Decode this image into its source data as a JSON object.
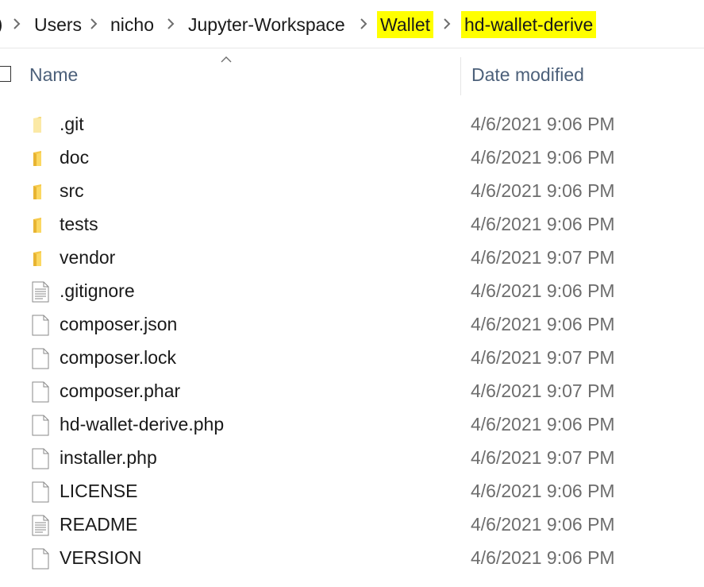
{
  "breadcrumb": {
    "items": [
      {
        "label": "Users",
        "highlighted": false
      },
      {
        "label": "nicho",
        "highlighted": false
      },
      {
        "label": "Jupyter-Workspace",
        "highlighted": false
      },
      {
        "label": "Wallet",
        "highlighted": true
      },
      {
        "label": "hd-wallet-derive",
        "highlighted": true
      }
    ],
    "highlight_color": "#ffff00"
  },
  "columns": {
    "name": "Name",
    "date_modified": "Date modified"
  },
  "files": [
    {
      "name": ".git",
      "type": "folder",
      "date": "4/6/2021 9:06 PM",
      "icon": "folder-light-icon"
    },
    {
      "name": "doc",
      "type": "folder",
      "date": "4/6/2021 9:06 PM",
      "icon": "folder-icon"
    },
    {
      "name": "src",
      "type": "folder",
      "date": "4/6/2021 9:06 PM",
      "icon": "folder-icon"
    },
    {
      "name": "tests",
      "type": "folder",
      "date": "4/6/2021 9:06 PM",
      "icon": "folder-icon"
    },
    {
      "name": "vendor",
      "type": "folder",
      "date": "4/6/2021 9:07 PM",
      "icon": "folder-icon"
    },
    {
      "name": ".gitignore",
      "type": "text",
      "date": "4/6/2021 9:06 PM",
      "icon": "text-file-icon"
    },
    {
      "name": "composer.json",
      "type": "file",
      "date": "4/6/2021 9:06 PM",
      "icon": "file-icon"
    },
    {
      "name": "composer.lock",
      "type": "file",
      "date": "4/6/2021 9:07 PM",
      "icon": "file-icon"
    },
    {
      "name": "composer.phar",
      "type": "file",
      "date": "4/6/2021 9:07 PM",
      "icon": "file-icon"
    },
    {
      "name": "hd-wallet-derive.php",
      "type": "file",
      "date": "4/6/2021 9:06 PM",
      "icon": "file-icon"
    },
    {
      "name": "installer.php",
      "type": "file",
      "date": "4/6/2021 9:07 PM",
      "icon": "file-icon"
    },
    {
      "name": "LICENSE",
      "type": "file",
      "date": "4/6/2021 9:06 PM",
      "icon": "file-icon"
    },
    {
      "name": "README",
      "type": "text",
      "date": "4/6/2021 9:06 PM",
      "icon": "text-file-icon"
    },
    {
      "name": "VERSION",
      "type": "file",
      "date": "4/6/2021 9:06 PM",
      "icon": "file-icon"
    }
  ]
}
